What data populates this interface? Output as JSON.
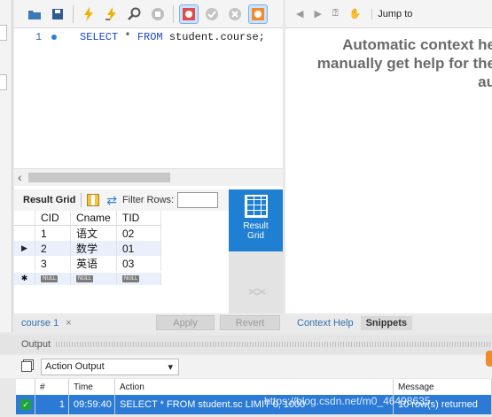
{
  "editor": {
    "line_number": "1",
    "code_keywords": [
      "SELECT",
      "FROM"
    ],
    "code_select": "SELECT",
    "code_star": " * ",
    "code_from": "FROM",
    "code_rest": " student.course;"
  },
  "result_toolbar": {
    "label": "Result Grid",
    "filter_label": "Filter Rows:"
  },
  "result_grid": {
    "columns": [
      "CID",
      "Cname",
      "TID"
    ],
    "rows": [
      [
        "1",
        "语文",
        "02"
      ],
      [
        "2",
        "数学",
        "01"
      ],
      [
        "3",
        "英语",
        "03"
      ]
    ],
    "null_label": "NULL"
  },
  "side_panel": {
    "tile_line1": "Result",
    "tile_line2": "Grid"
  },
  "bottom_tabs": {
    "query_tab": "course 1",
    "close": "×",
    "apply": "Apply",
    "revert": "Revert",
    "context_help": "Context Help",
    "snippets": "Snippets"
  },
  "context_help": {
    "jump_to": "Jump to",
    "line1": "Automatic context he",
    "line2": "manually get help for the",
    "line3": "au"
  },
  "output": {
    "title": "Output",
    "selector": "Action Output",
    "columns": [
      "#",
      "Time",
      "Action",
      "Message"
    ],
    "row": {
      "num": "1",
      "time": "09:59:40",
      "action": "SELECT * FROM student.sc LIMIT 0, 1000",
      "message": "10 row(s) returned"
    }
  },
  "watermark": "https://blog.csdn.net/m0_46498635",
  "colors": {
    "accent": "#1f7fd3",
    "keyword": "#1a46c9",
    "selected_row": "#2a7ad6",
    "ok": "#22a339"
  }
}
